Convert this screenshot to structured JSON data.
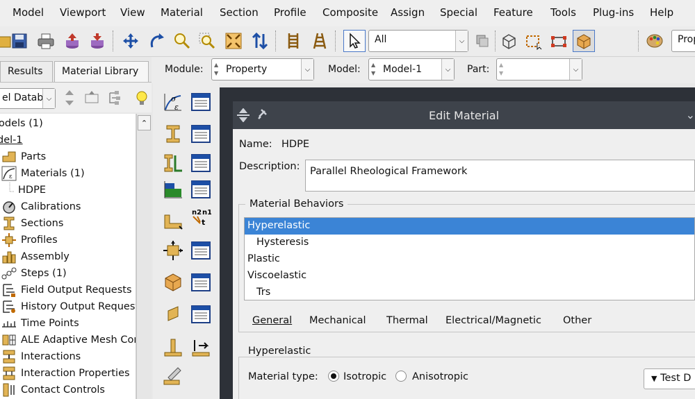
{
  "menubar": [
    "Model",
    "Viewport",
    "View",
    "Material",
    "Section",
    "Profile",
    "Composite",
    "Assign",
    "Special",
    "Feature",
    "Tools",
    "Plug-ins",
    "Help"
  ],
  "toolbar": {
    "selection_filter": "All",
    "render_combo": "Prop"
  },
  "left_panel": {
    "tabs": [
      "Results",
      "Material Library"
    ],
    "database_combo": "el Databas",
    "tree": {
      "root": "odels  (1)",
      "model": "del-1",
      "items": [
        {
          "label": "Parts",
          "icon": "parts-icon"
        },
        {
          "label": "Materials  (1)",
          "icon": "materials-icon"
        },
        {
          "label": "HDPE",
          "icon": "tree-leaf-icon"
        },
        {
          "label": "Calibrations",
          "icon": "calibrations-icon"
        },
        {
          "label": "Sections",
          "icon": "sections-icon"
        },
        {
          "label": "Profiles",
          "icon": "profiles-icon"
        },
        {
          "label": "Assembly",
          "icon": "assembly-icon"
        },
        {
          "label": "Steps  (1)",
          "icon": "steps-icon"
        },
        {
          "label": "Field Output Requests",
          "icon": "field-output-icon"
        },
        {
          "label": "History Output Request",
          "icon": "history-output-icon"
        },
        {
          "label": "Time Points",
          "icon": "time-points-icon"
        },
        {
          "label": "ALE Adaptive Mesh Con",
          "icon": "ale-mesh-icon"
        },
        {
          "label": "Interactions",
          "icon": "interactions-icon"
        },
        {
          "label": "Interaction Properties",
          "icon": "interaction-properties-icon"
        },
        {
          "label": "Contact Controls",
          "icon": "contact-controls-icon"
        }
      ]
    }
  },
  "module_bar": {
    "module_label": "Module:",
    "module_value": "Property",
    "model_label": "Model:",
    "model_value": "Model-1",
    "part_label": "Part:",
    "part_value": ""
  },
  "dialog": {
    "title": "Edit Material",
    "name_label": "Name:",
    "name_value": "HDPE",
    "description_label": "Description:",
    "description_value": "Parallel  Rheological  Framework",
    "behaviors_title": "Material Behaviors",
    "behaviors": [
      "Hyperelastic",
      "Hysteresis",
      "Plastic",
      "Viscoelastic",
      "Trs"
    ],
    "menu_tabs": [
      "General",
      "Mechanical",
      "Thermal",
      "Electrical/Magnetic",
      "Other"
    ],
    "section_title": "Hyperelastic",
    "material_type_label": "Material type:",
    "isotropic_label": "Isotropic",
    "anisotropic_label": "Anisotropic",
    "test_data_label": "Test D"
  },
  "colors": {
    "selection": "#3b84d6",
    "dialog_frame": "#2d3138",
    "titlebar": "#3e434b"
  }
}
